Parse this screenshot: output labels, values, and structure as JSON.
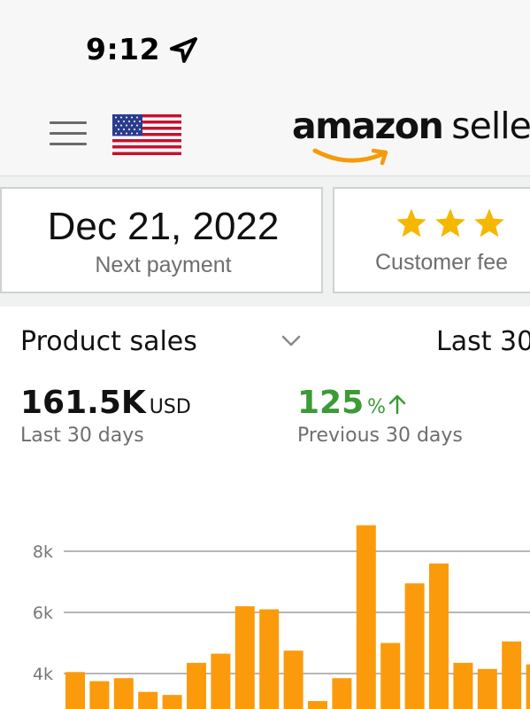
{
  "status_bar": {
    "time": "9:12",
    "location_icon": "location-arrow-icon"
  },
  "header": {
    "menu_icon": "hamburger-menu-icon",
    "flag_icon": "us-flag-icon",
    "logo": {
      "brand": "amazon",
      "sub": "seller"
    }
  },
  "cards": {
    "payment": {
      "value": "Dec 21, 2022",
      "label": "Next payment"
    },
    "feedback": {
      "stars": 3,
      "label": "Customer fee"
    }
  },
  "sales": {
    "title": "Product sales",
    "period": "Last 30",
    "total": {
      "value": "161.5K",
      "unit": "USD",
      "caption": "Last 30 days"
    },
    "change": {
      "value": "125",
      "unit": "%",
      "direction": "up",
      "caption": "Previous 30 days"
    }
  },
  "colors": {
    "bar": "#fb9b0c",
    "positive": "#3c9a37",
    "star": "#f6b700",
    "gridline": "#8a8a8a"
  },
  "chart_data": {
    "type": "bar",
    "yticks": [
      "8k",
      "6k",
      "4k"
    ],
    "ytick_values": [
      8000,
      6000,
      4000
    ],
    "grid": true,
    "values": [
      4050,
      3750,
      3850,
      3400,
      3300,
      4350,
      4650,
      6200,
      6100,
      4750,
      3100,
      3850,
      8850,
      5000,
      6950,
      7600,
      4350,
      4150,
      5050,
      4300
    ]
  }
}
